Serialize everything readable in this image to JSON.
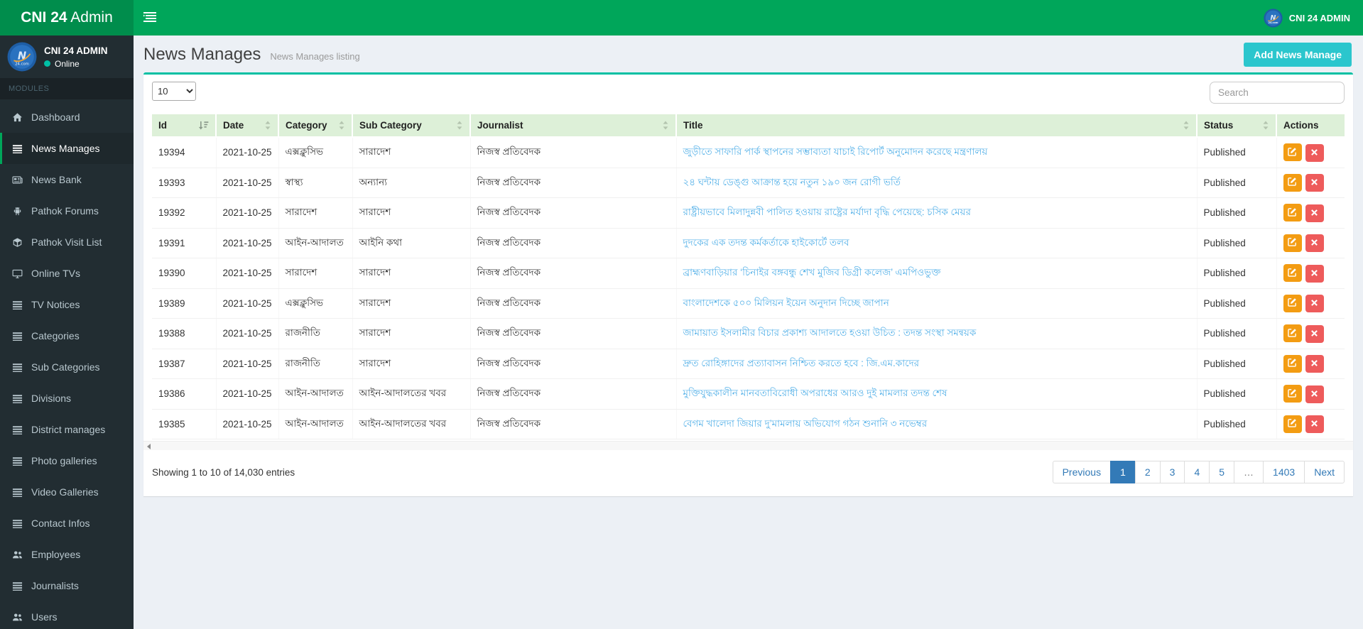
{
  "app": {
    "logo_bold": "CNI 24",
    "logo_light": " Admin",
    "topbar_user": "CNI 24 ADMIN"
  },
  "sidebar": {
    "user_name": "CNI 24 ADMIN",
    "user_status": "Online",
    "modules_label": "MODULES",
    "items": [
      {
        "label": "Dashboard",
        "icon": "home-icon",
        "active": false
      },
      {
        "label": "News Manages",
        "icon": "list-icon",
        "active": true
      },
      {
        "label": "News Bank",
        "icon": "newspaper-icon",
        "active": false
      },
      {
        "label": "Pathok Forums",
        "icon": "android-icon",
        "active": false
      },
      {
        "label": "Pathok Visit List",
        "icon": "cube-icon",
        "active": false
      },
      {
        "label": "Online TVs",
        "icon": "desktop-icon",
        "active": false
      },
      {
        "label": "TV Notices",
        "icon": "list-icon",
        "active": false
      },
      {
        "label": "Categories",
        "icon": "list-icon",
        "active": false
      },
      {
        "label": "Sub Categories",
        "icon": "list-icon",
        "active": false
      },
      {
        "label": "Divisions",
        "icon": "list-icon",
        "active": false
      },
      {
        "label": "District manages",
        "icon": "list-icon",
        "active": false
      },
      {
        "label": "Photo galleries",
        "icon": "list-icon",
        "active": false
      },
      {
        "label": "Video Galleries",
        "icon": "list-icon",
        "active": false
      },
      {
        "label": "Contact Infos",
        "icon": "list-icon",
        "active": false
      },
      {
        "label": "Employees",
        "icon": "users-icon",
        "active": false
      },
      {
        "label": "Journalists",
        "icon": "list-icon",
        "active": false
      },
      {
        "label": "Users",
        "icon": "users-icon",
        "active": false
      }
    ]
  },
  "page": {
    "title": "News Manages",
    "subtitle": "News Manages listing",
    "add_button": "Add News Manage"
  },
  "toolbar": {
    "page_length": "10",
    "search_placeholder": "Search"
  },
  "table": {
    "columns": [
      {
        "label": "Id",
        "sortable": true,
        "sorted": "desc"
      },
      {
        "label": "Date",
        "sortable": true,
        "sorted": null
      },
      {
        "label": "Category",
        "sortable": true,
        "sorted": null
      },
      {
        "label": "Sub Category",
        "sortable": true,
        "sorted": null
      },
      {
        "label": "Journalist",
        "sortable": true,
        "sorted": null
      },
      {
        "label": "Title",
        "sortable": true,
        "sorted": null
      },
      {
        "label": "Status",
        "sortable": true,
        "sorted": null
      },
      {
        "label": "Actions",
        "sortable": false,
        "sorted": null
      }
    ],
    "rows": [
      {
        "id": "19394",
        "date": "2021-10-25",
        "category": "এক্সক্লুসিভ",
        "sub_category": "সারাদেশ",
        "journalist": "নিজস্ব প্রতিবেদক",
        "title": "জুড়ীতে সাফারি পার্ক স্থাপনের সম্ভাব্যতা যাচাই রিপোর্ট অনুমোদন করেছে মন্ত্রণালয়",
        "status": "Published"
      },
      {
        "id": "19393",
        "date": "2021-10-25",
        "category": "স্বাস্থ্য",
        "sub_category": "অন্যান্য",
        "journalist": "নিজস্ব প্রতিবেদক",
        "title": "২৪ ঘন্টায় ডেঙ্গু আক্রান্ত হয়ে নতুন ১৯০ জন রোগী ভর্তি",
        "status": "Published"
      },
      {
        "id": "19392",
        "date": "2021-10-25",
        "category": "সারাদেশ",
        "sub_category": "সারাদেশ",
        "journalist": "নিজস্ব প্রতিবেদক",
        "title": "রাষ্ট্রীয়ভাবে মিলাদুন্নবী পালিত হওয়ায় রাষ্ট্রের মর্যাদা বৃদ্ধি পেয়েছে: চসিক মেয়র",
        "status": "Published"
      },
      {
        "id": "19391",
        "date": "2021-10-25",
        "category": "আইন-আদালত",
        "sub_category": "আইনি কথা",
        "journalist": "নিজস্ব প্রতিবেদক",
        "title": "দুদকের এক তদন্ত কর্মকর্তাকে হাইকোর্টে তলব",
        "status": "Published"
      },
      {
        "id": "19390",
        "date": "2021-10-25",
        "category": "সারাদেশ",
        "sub_category": "সারাদেশ",
        "journalist": "নিজস্ব প্রতিবেদক",
        "title": "ব্রাহ্মণবাড়িয়ার ‘চিনাইর বঙ্গবন্ধু শেখ মুজিব ডিগ্রী কলেজ’ এমপিওভুক্ত",
        "status": "Published"
      },
      {
        "id": "19389",
        "date": "2021-10-25",
        "category": "এক্সক্লুসিভ",
        "sub_category": "সারাদেশ",
        "journalist": "নিজস্ব প্রতিবেদক",
        "title": "বাংলাদেশকে ৫০০ মিলিয়ন ইয়েন অনুদান দিচ্ছে জাপান",
        "status": "Published"
      },
      {
        "id": "19388",
        "date": "2021-10-25",
        "category": "রাজনীতি",
        "sub_category": "সারাদেশ",
        "journalist": "নিজস্ব প্রতিবেদক",
        "title": "জামায়াত ইসলামীর বিচার প্রকাশ্য আদালতে হওয়া উচিত : তদন্ত সংস্থা সমন্বয়ক",
        "status": "Published"
      },
      {
        "id": "19387",
        "date": "2021-10-25",
        "category": "রাজনীতি",
        "sub_category": "সারাদেশ",
        "journalist": "নিজস্ব প্রতিবেদক",
        "title": "দ্রুত রোহিঙ্গাদের প্রত্যাবাসন নিশ্চিত করতে হবে : জি.এম.কাদের",
        "status": "Published"
      },
      {
        "id": "19386",
        "date": "2021-10-25",
        "category": "আইন-আদালত",
        "sub_category": "আইন-আদালতের খবর",
        "journalist": "নিজস্ব প্রতিবেদক",
        "title": "মুক্তিযুদ্ধকালীন মানবতাবিরোধী অপরাধের আরও দুই মামলার তদন্ত শেষ",
        "status": "Published"
      },
      {
        "id": "19385",
        "date": "2021-10-25",
        "category": "আইন-আদালত",
        "sub_category": "আইন-আদালতের খবর",
        "journalist": "নিজস্ব প্রতিবেদক",
        "title": "বেগম খালেদা জিয়ার দু’মামলায় অভিযোগ গঠন শুনানি ৩ নভেম্বর",
        "status": "Published"
      }
    ]
  },
  "footer": {
    "showing_text": "Showing 1 to 10 of 14,030 entries",
    "previous_label": "Previous",
    "pages": [
      "1",
      "2",
      "3",
      "4",
      "5",
      "…",
      "1403"
    ],
    "active_page": "1",
    "next_label": "Next"
  },
  "colors": {
    "navbar_green": "#00a65a",
    "logo_green": "#008d4c",
    "sidebar_dark": "#222d32",
    "box_top_border": "#00c0a3",
    "add_button": "#2bc6cd",
    "table_header_bg": "#ddf0d8",
    "title_link": "#55b1e8",
    "edit_button": "#f39c12",
    "delete_button": "#ee5b5b",
    "pagination_active": "#337ab7",
    "online_dot": "#00bfa5"
  }
}
